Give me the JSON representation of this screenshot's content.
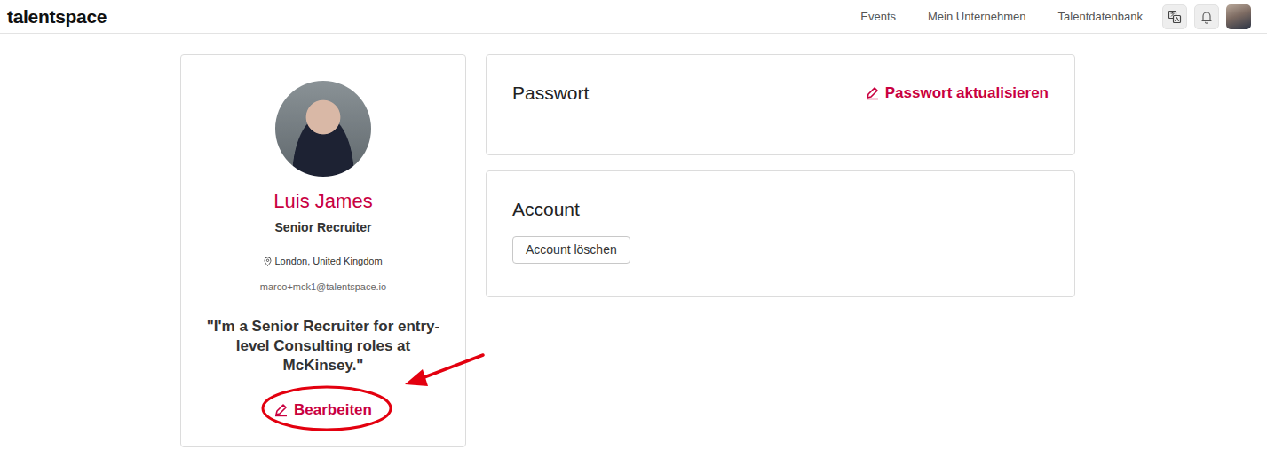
{
  "navbar": {
    "logo": "talentspace",
    "links": [
      "Events",
      "Mein Unternehmen",
      "Talentdatenbank"
    ]
  },
  "profile": {
    "name": "Luis James",
    "role": "Senior Recruiter",
    "location": "London, United Kingdom",
    "email": "marco+mck1@talentspace.io",
    "quote": "\"I'm a Senior Recruiter for entry-level Consulting roles at McKinsey.\"",
    "edit": "Bearbeiten"
  },
  "password": {
    "title": "Passwort",
    "action": "Passwort aktualisieren"
  },
  "account": {
    "title": "Account",
    "button": "Account löschen"
  }
}
